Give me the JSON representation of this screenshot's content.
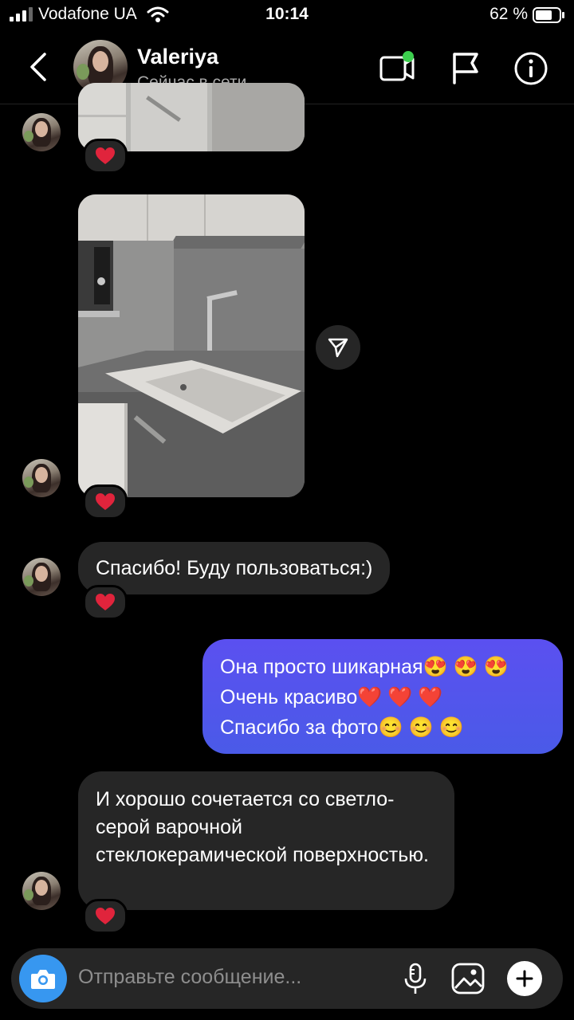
{
  "status_bar": {
    "carrier": "Vodafone UA",
    "time": "10:14",
    "battery": "62 %"
  },
  "header": {
    "name": "Valeriya",
    "presence": "Сейчас в сети"
  },
  "messages": {
    "text_1": "Спасибо! Буду пользоваться:)",
    "outgoing_lines": [
      "Она просто шикарная😍 😍 😍",
      "Очень красиво❤️ ❤️ ❤️",
      "Спасибо за фото😊 😊 😊"
    ],
    "text_2": "И хорошо сочетается со светло-серой варочной стеклокерамической поверхностью."
  },
  "composer": {
    "placeholder": "Отправьте сообщение..."
  },
  "colors": {
    "outgoing_bubble": "#5451ee",
    "incoming_bubble": "#262626",
    "presence_dot": "#3ccf4e",
    "heart": "#e0243c"
  }
}
